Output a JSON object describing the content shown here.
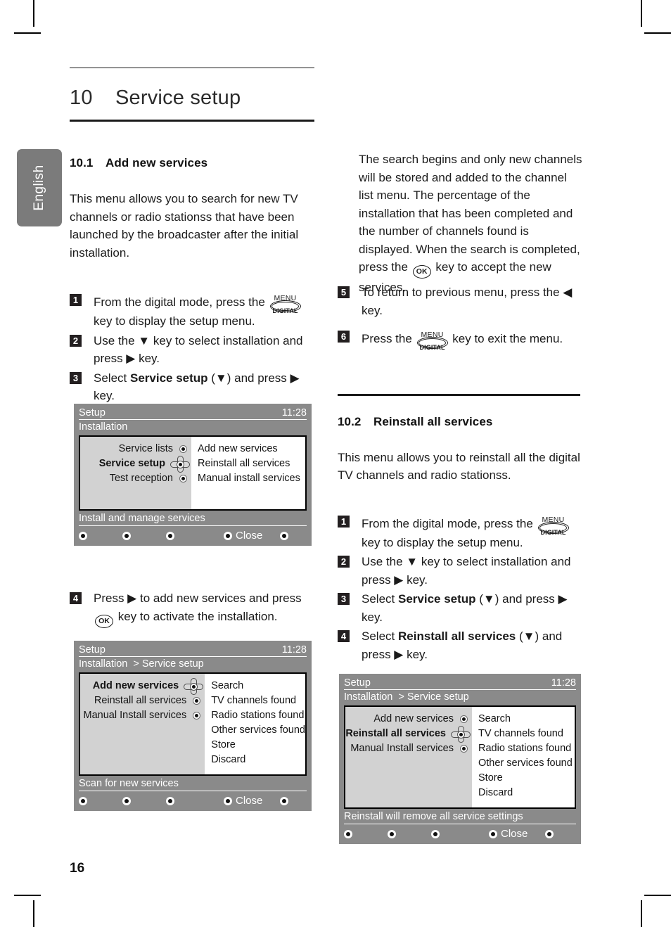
{
  "page": {
    "folio": "16",
    "language_tab": "English"
  },
  "chapter": {
    "number": "10",
    "title": "Service setup"
  },
  "sections": {
    "add_new": {
      "number": "10.1",
      "title": "Add new services",
      "intro": "This menu allows you to search for new TV channels or radio stationss that have been launched by the broadcaster after the initial installation.",
      "steps": [
        {
          "n": "1",
          "html": "From the digital mode, press the {DIGITAL} key to display the setup menu."
        },
        {
          "n": "2",
          "html": "Use the ▼ key to select installation and press ▶ key."
        },
        {
          "n": "3",
          "html": "Select <b>Service setup</b> (▼) and press ▶ key."
        },
        {
          "n": "4",
          "html": "Press ▶ to add new services and press {OK} key to activate the installation."
        }
      ]
    },
    "search_note": {
      "body": "The search begins and only new channels will be stored and added to the channel list menu. The percentage of the installation that has been completed and the number of channels found is displayed. When the search is completed, press the {OK} key to accept the new services.",
      "steps": [
        {
          "n": "5",
          "html": "To return to previous menu, press the ◀ key."
        },
        {
          "n": "6",
          "html": "Press the {DIGITAL} key to exit the menu."
        }
      ]
    },
    "reinstall": {
      "number": "10.2",
      "title": "Reinstall all services",
      "intro": "This menu allows you to reinstall all the digital TV channels and radio stationss.",
      "steps": [
        {
          "n": "1",
          "html": "From the digital mode, press the {DIGITAL} key to display the setup menu."
        },
        {
          "n": "2",
          "html": "Use the ▼ key to select installation and press ▶ key."
        },
        {
          "n": "3",
          "html": "Select <b>Service setup</b> (▼) and press ▶ key."
        },
        {
          "n": "4",
          "html": "Select <b>Reinstall all services</b> (▼) and press ▶ key."
        }
      ]
    }
  },
  "keys": {
    "digital_top_label": "MENU",
    "digital_label": "DIGITAL",
    "ok_label": "OK"
  },
  "tv_screens": [
    {
      "id": "installation-menu",
      "title": "Setup",
      "clock": "11:28",
      "breadcrumb": "Installation",
      "left_items": [
        {
          "label": "Service lists",
          "selected": false,
          "marker": "dot"
        },
        {
          "label": "Service setup",
          "selected": true,
          "marker": "dpad"
        },
        {
          "label": "Test reception",
          "selected": false,
          "marker": "dot"
        }
      ],
      "right_items": [
        "Add new services",
        "Reinstall all services",
        "Manual install services"
      ],
      "hint": "Install and manage services",
      "softkeys": [
        "",
        "",
        "",
        "Close",
        ""
      ]
    },
    {
      "id": "service-setup-add",
      "title": "Setup",
      "clock": "11:28",
      "breadcrumb": "Installation  > Service setup",
      "left_items": [
        {
          "label": "Add new services",
          "selected": true,
          "marker": "dpad"
        },
        {
          "label": "Reinstall all services",
          "selected": false,
          "marker": "dot"
        },
        {
          "label": "Manual Install services",
          "selected": false,
          "marker": "dot"
        }
      ],
      "right_items": [
        "Search",
        "TV channels found",
        "Radio stations found",
        "Other services found",
        "Store",
        "Discard"
      ],
      "hint": "Scan for new services",
      "softkeys": [
        "",
        "",
        "",
        "Close",
        ""
      ]
    },
    {
      "id": "service-setup-reinstall",
      "title": "Setup",
      "clock": "11:28",
      "breadcrumb": "Installation  > Service setup",
      "left_items": [
        {
          "label": "Add new services",
          "selected": false,
          "marker": "dot"
        },
        {
          "label": "Reinstall all services",
          "selected": true,
          "marker": "dpad"
        },
        {
          "label": "Manual Install services",
          "selected": false,
          "marker": "dot"
        }
      ],
      "right_items": [
        "Search",
        "TV channels found",
        "Radio stations found",
        "Other services found",
        "Store",
        "Discard"
      ],
      "hint": "Reinstall will remove all service settings",
      "softkeys": [
        "",
        "",
        "",
        "Close",
        ""
      ]
    }
  ],
  "colors": {
    "tv_chrome": "#8a8a8a",
    "tv_left_panel": "#d2d2d2",
    "tab_gray": "#7b7b7b",
    "ink": "#1a1a1a"
  }
}
